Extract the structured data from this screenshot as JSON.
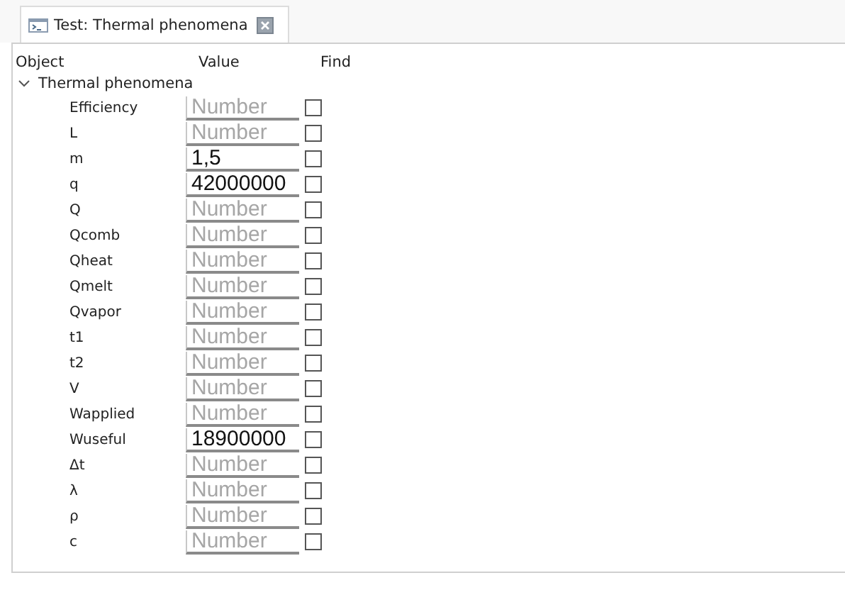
{
  "tab": {
    "title": "Test: Thermal phenomena",
    "closable": true
  },
  "table": {
    "columns": [
      "Object",
      "Value",
      "Find"
    ],
    "group": {
      "label": "Thermal phenomena",
      "expanded": true,
      "rows": [
        {
          "name": "Efficiency",
          "placeholder": "Number",
          "find": false
        },
        {
          "name": "L",
          "placeholder": "Number",
          "find": false
        },
        {
          "name": "m",
          "value": "1,5",
          "find": false
        },
        {
          "name": "q",
          "value": "42000000",
          "find": false
        },
        {
          "name": "Q",
          "placeholder": "Number",
          "find": false
        },
        {
          "name": "Qcomb",
          "placeholder": "Number",
          "find": false
        },
        {
          "name": "Qheat",
          "placeholder": "Number",
          "find": false
        },
        {
          "name": "Qmelt",
          "placeholder": "Number",
          "find": false
        },
        {
          "name": "Qvapor",
          "placeholder": "Number",
          "find": false
        },
        {
          "name": "t1",
          "placeholder": "Number",
          "find": false
        },
        {
          "name": "t2",
          "placeholder": "Number",
          "find": false
        },
        {
          "name": "V",
          "placeholder": "Number",
          "find": false
        },
        {
          "name": "Wapplied",
          "placeholder": "Number",
          "find": false
        },
        {
          "name": "Wuseful",
          "value": "18900000",
          "find": false
        },
        {
          "name": "Δt",
          "placeholder": "Number",
          "find": false
        },
        {
          "name": "λ",
          "placeholder": "Number",
          "find": false
        },
        {
          "name": "ρ",
          "placeholder": "Number",
          "find": false
        },
        {
          "name": "c",
          "placeholder": "Number",
          "find": false
        }
      ]
    }
  }
}
